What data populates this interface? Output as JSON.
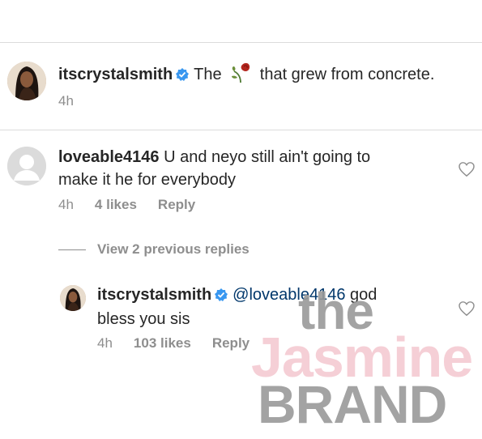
{
  "post": {
    "username": "itscrystalsmith",
    "caption_before": "The",
    "caption_emoji": "wilted-rose",
    "caption_after": "that grew from concrete.",
    "time": "4h"
  },
  "comment": {
    "username": "loveable4146",
    "text_line1": "U and neyo  still ain't going to",
    "text_line2": "make it he for everybody",
    "time": "4h",
    "likes": "4 likes",
    "reply_label": "Reply"
  },
  "view_replies": "View 2 previous replies",
  "reply": {
    "username": "itscrystalsmith",
    "mention": "@loveable4146",
    "text_after_mention": "god",
    "text_line2": "bless you sis",
    "time": "4h",
    "likes": "103 likes",
    "reply_label": "Reply"
  },
  "watermark": {
    "line1": "the",
    "line2": "Jasmine",
    "line3": "BRAND"
  },
  "colors": {
    "verified": "#3897f0",
    "meta": "#8e8e8e",
    "mention": "#00376b",
    "watermark_gray": "#9a9a9a",
    "watermark_pink": "#f4c7cf"
  }
}
